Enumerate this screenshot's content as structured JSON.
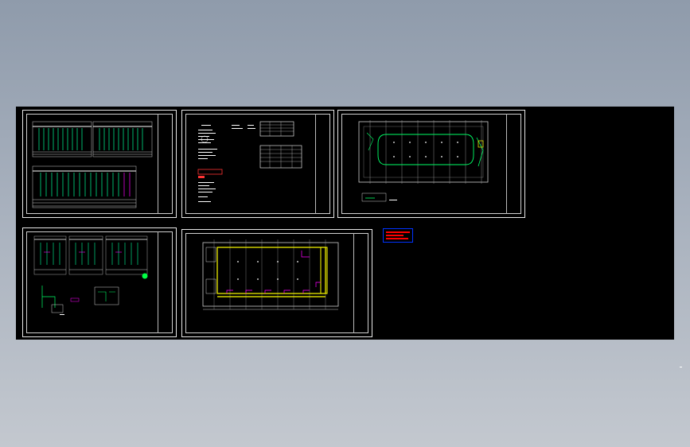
{
  "viewport": {
    "background": "#000000",
    "accent_green": "#00ff66",
    "accent_cyan": "#00ffff",
    "accent_yellow": "#ffff00",
    "accent_magenta": "#ff00ff",
    "accent_red": "#ff0000",
    "accent_blue": "#0033ff"
  },
  "sheets": [
    {
      "id": "sheet-1",
      "kind": "distribution-schematic"
    },
    {
      "id": "sheet-2",
      "kind": "notes-and-tables"
    },
    {
      "id": "sheet-3",
      "kind": "lighting-plan"
    },
    {
      "id": "sheet-4",
      "kind": "panel-schedules"
    },
    {
      "id": "sheet-5",
      "kind": "power-plan"
    }
  ],
  "legend_block": {
    "kind": "red-blue-legend"
  }
}
